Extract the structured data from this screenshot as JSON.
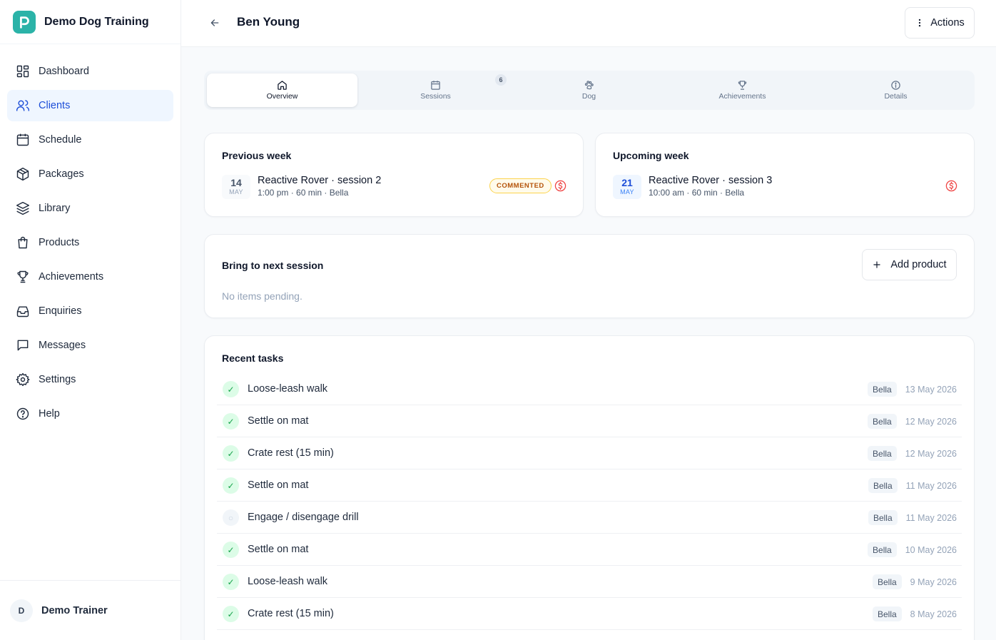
{
  "brand": {
    "name": "Demo Dog Training",
    "logo_color": "#2bb3a8"
  },
  "sidebar": {
    "items": [
      {
        "label": "Dashboard",
        "icon": "dashboard-icon",
        "active": false
      },
      {
        "label": "Clients",
        "icon": "users-icon",
        "active": true
      },
      {
        "label": "Schedule",
        "icon": "calendar-icon",
        "active": false
      },
      {
        "label": "Packages",
        "icon": "package-icon",
        "active": false
      },
      {
        "label": "Library",
        "icon": "layers-icon",
        "active": false
      },
      {
        "label": "Products",
        "icon": "shopping-bag-icon",
        "active": false
      },
      {
        "label": "Achievements",
        "icon": "trophy-icon",
        "active": false
      },
      {
        "label": "Enquiries",
        "icon": "inbox-icon",
        "active": false
      },
      {
        "label": "Messages",
        "icon": "message-icon",
        "active": false
      },
      {
        "label": "Settings",
        "icon": "gear-icon",
        "active": false
      },
      {
        "label": "Help",
        "icon": "help-icon",
        "active": false
      }
    ],
    "user": {
      "initial": "D",
      "name": "Demo Trainer"
    }
  },
  "header": {
    "title": "Ben Young",
    "actions_label": "Actions"
  },
  "tabs": [
    {
      "label": "Overview",
      "icon": "home-icon",
      "active": true
    },
    {
      "label": "Sessions",
      "icon": "calendar-icon",
      "active": false,
      "badge": "6"
    },
    {
      "label": "Dog",
      "icon": "paw-icon",
      "active": false
    },
    {
      "label": "Achievements",
      "icon": "trophy-icon",
      "active": false
    },
    {
      "label": "Details",
      "icon": "info-icon",
      "active": false
    }
  ],
  "previous_week": {
    "title": "Previous week",
    "day": "14",
    "month": "MAY",
    "session": "Reactive Rover · session 2",
    "meta": "1:00 pm · 60 min · Bella",
    "badge": "COMMENTED"
  },
  "upcoming_week": {
    "title": "Upcoming week",
    "day": "21",
    "month": "MAY",
    "session": "Reactive Rover · session 3",
    "meta": "10:00 am · 60 min · Bella"
  },
  "bring": {
    "title": "Bring to next session",
    "add_label": "Add product",
    "empty": "No items pending."
  },
  "tasks": {
    "title": "Recent tasks",
    "rows": [
      {
        "name": "Loose-leash walk",
        "dog": "Bella",
        "date": "13 May 2026",
        "done": true
      },
      {
        "name": "Settle on mat",
        "dog": "Bella",
        "date": "12 May 2026",
        "done": true
      },
      {
        "name": "Crate rest (15 min)",
        "dog": "Bella",
        "date": "12 May 2026",
        "done": true
      },
      {
        "name": "Settle on mat",
        "dog": "Bella",
        "date": "11 May 2026",
        "done": true
      },
      {
        "name": "Engage / disengage drill",
        "dog": "Bella",
        "date": "11 May 2026",
        "done": false
      },
      {
        "name": "Settle on mat",
        "dog": "Bella",
        "date": "10 May 2026",
        "done": true
      },
      {
        "name": "Loose-leash walk",
        "dog": "Bella",
        "date": "9 May 2026",
        "done": true
      },
      {
        "name": "Crate rest (15 min)",
        "dog": "Bella",
        "date": "8 May 2026",
        "done": true
      }
    ],
    "check_glyph": "✓",
    "pending_glyph": "○"
  },
  "colors": {
    "accent": "#1d4ed8",
    "active_bg": "#eff6ff",
    "success": "#16a34a",
    "warning": "#b45309",
    "danger": "#ef4444"
  }
}
